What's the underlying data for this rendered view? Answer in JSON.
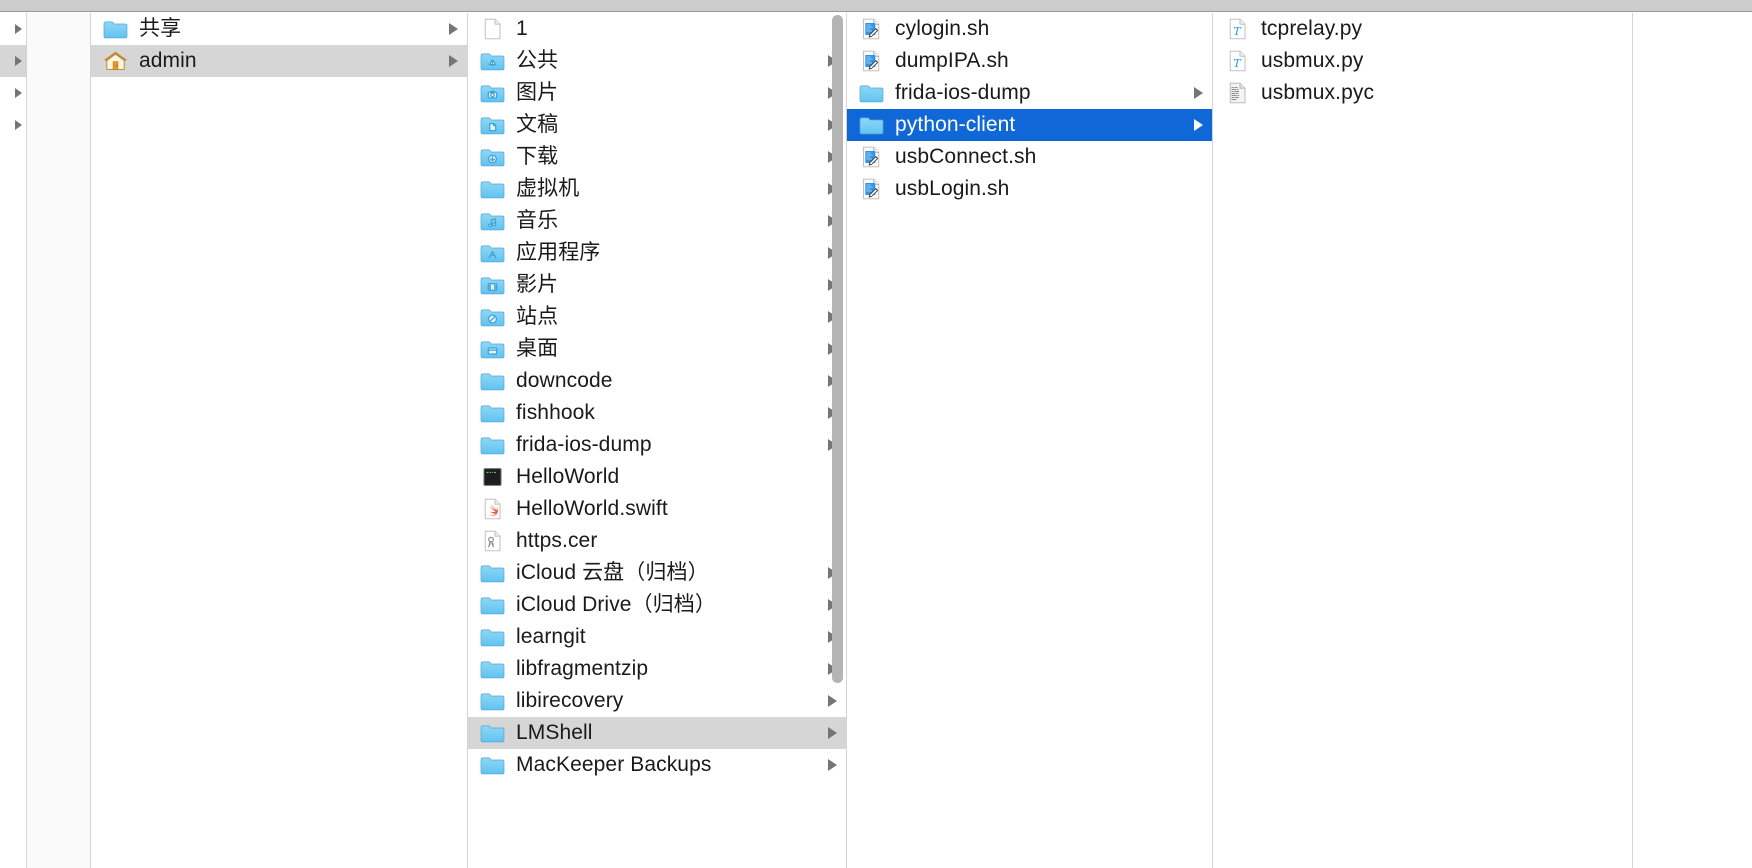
{
  "app": {
    "name": "Finder",
    "view_mode": "column",
    "selection_color": "#1067d8",
    "inactive_selection_color": "#d6d6d6",
    "chrome_color": "#cccccc",
    "gutter_color": "#fafafa",
    "scrollbar_color": "#b4b4b4"
  },
  "columns": [
    {
      "id": "col-stub",
      "name": "devices-stub-column",
      "items": [
        {
          "label": "",
          "icon": "none",
          "has_children": true,
          "selected": "none"
        },
        {
          "label": "",
          "icon": "none",
          "has_children": true,
          "selected": "inactive"
        },
        {
          "label": "",
          "icon": "none",
          "has_children": true,
          "selected": "none"
        },
        {
          "label": "",
          "icon": "none",
          "has_children": true,
          "selected": "none"
        }
      ]
    },
    {
      "id": "col-gutter",
      "name": "empty-gutter-column",
      "items": []
    },
    {
      "id": "col-users",
      "name": "users-column",
      "items": [
        {
          "label": "共享",
          "icon": "folder-plain",
          "has_children": true,
          "selected": "none"
        },
        {
          "label": "admin",
          "icon": "home-folder",
          "has_children": true,
          "selected": "inactive"
        }
      ]
    },
    {
      "id": "col-home",
      "name": "home-folder-column",
      "scrollbar": {
        "visible": true,
        "thumb_top_pct": 0,
        "thumb_height_pct": 81
      },
      "items": [
        {
          "label": "1",
          "icon": "file-blank",
          "has_children": false,
          "selected": "none"
        },
        {
          "label": "公共",
          "icon": "folder-public",
          "has_children": true,
          "selected": "none"
        },
        {
          "label": "图片",
          "icon": "folder-pictures",
          "has_children": true,
          "selected": "none"
        },
        {
          "label": "文稿",
          "icon": "folder-documents",
          "has_children": true,
          "selected": "none"
        },
        {
          "label": "下载",
          "icon": "folder-downloads",
          "has_children": true,
          "selected": "none"
        },
        {
          "label": "虚拟机",
          "icon": "folder-plain",
          "has_children": true,
          "selected": "none"
        },
        {
          "label": "音乐",
          "icon": "folder-music",
          "has_children": true,
          "selected": "none"
        },
        {
          "label": "应用程序",
          "icon": "folder-apps",
          "has_children": true,
          "selected": "none"
        },
        {
          "label": "影片",
          "icon": "folder-movies",
          "has_children": true,
          "selected": "none"
        },
        {
          "label": "站点",
          "icon": "folder-sites",
          "has_children": true,
          "selected": "none"
        },
        {
          "label": "桌面",
          "icon": "folder-desktop",
          "has_children": true,
          "selected": "none"
        },
        {
          "label": "downcode",
          "icon": "folder-plain",
          "has_children": true,
          "selected": "none"
        },
        {
          "label": "fishhook",
          "icon": "folder-plain",
          "has_children": true,
          "selected": "none"
        },
        {
          "label": "frida-ios-dump",
          "icon": "folder-plain",
          "has_children": true,
          "selected": "none"
        },
        {
          "label": "HelloWorld",
          "icon": "file-unix-exec",
          "has_children": false,
          "selected": "none"
        },
        {
          "label": "HelloWorld.swift",
          "icon": "file-swift",
          "has_children": false,
          "selected": "none"
        },
        {
          "label": "https.cer",
          "icon": "file-certificate",
          "has_children": false,
          "selected": "none"
        },
        {
          "label": "iCloud 云盘（归档）",
          "icon": "folder-plain",
          "has_children": true,
          "selected": "none"
        },
        {
          "label": "iCloud Drive（归档）",
          "icon": "folder-plain",
          "has_children": true,
          "selected": "none"
        },
        {
          "label": "learngit",
          "icon": "folder-plain",
          "has_children": true,
          "selected": "none"
        },
        {
          "label": "libfragmentzip",
          "icon": "folder-plain",
          "has_children": true,
          "selected": "none"
        },
        {
          "label": "libirecovery",
          "icon": "folder-plain",
          "has_children": true,
          "selected": "none"
        },
        {
          "label": "LMShell",
          "icon": "folder-plain",
          "has_children": true,
          "selected": "inactive"
        },
        {
          "label": "MacKeeper Backups",
          "icon": "folder-plain",
          "has_children": true,
          "selected": "none"
        }
      ]
    },
    {
      "id": "col-frida-ios-dump",
      "name": "frida-ios-dump-column",
      "items": [
        {
          "label": "cylogin.sh",
          "icon": "file-shell",
          "has_children": false,
          "selected": "none"
        },
        {
          "label": "dumpIPA.sh",
          "icon": "file-shell",
          "has_children": false,
          "selected": "none"
        },
        {
          "label": "frida-ios-dump",
          "icon": "folder-plain",
          "has_children": true,
          "selected": "none"
        },
        {
          "label": "python-client",
          "icon": "folder-plain",
          "has_children": true,
          "selected": "active"
        },
        {
          "label": "usbConnect.sh",
          "icon": "file-shell",
          "has_children": false,
          "selected": "none"
        },
        {
          "label": "usbLogin.sh",
          "icon": "file-shell",
          "has_children": false,
          "selected": "none"
        }
      ]
    },
    {
      "id": "col-python-client",
      "name": "python-client-column",
      "items": [
        {
          "label": "tcprelay.py",
          "icon": "file-python",
          "has_children": false,
          "selected": "none"
        },
        {
          "label": "usbmux.py",
          "icon": "file-python",
          "has_children": false,
          "selected": "none"
        },
        {
          "label": "usbmux.pyc",
          "icon": "file-binary",
          "has_children": false,
          "selected": "none"
        }
      ]
    },
    {
      "id": "col-tail",
      "name": "empty-preview-column",
      "items": []
    }
  ]
}
